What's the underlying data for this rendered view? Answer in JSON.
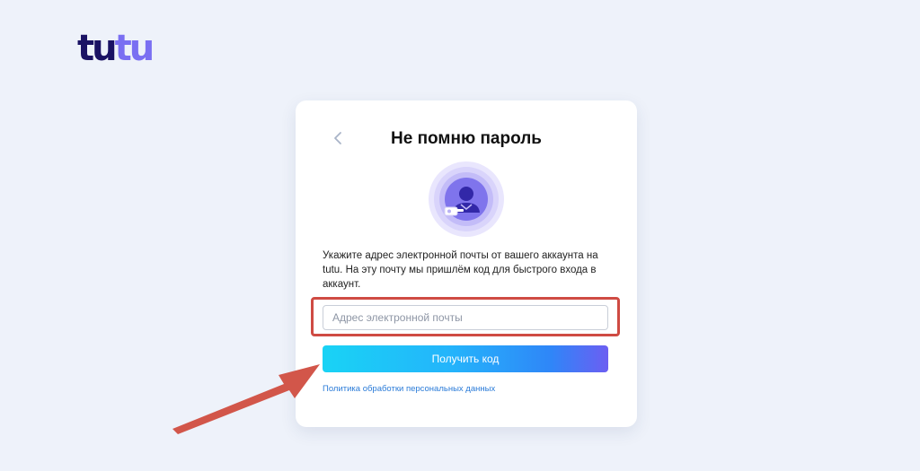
{
  "logo": {
    "part1": "tu",
    "part2": "tu"
  },
  "card": {
    "back_icon": "chevron-left-icon",
    "title": "Не помню пароль",
    "illustration_icon": "user-key-icon",
    "description": "Укажите адрес электронной почты от вашего аккаунта на tutu. На эту почту мы пришлём код для быстрого входа в аккаунт.",
    "email": {
      "value": "",
      "placeholder": "Адрес электронной почты"
    },
    "submit_label": "Получить код",
    "policy_link": "Политика обработки персональных данных"
  },
  "annotations": {
    "highlight_color": "#cf4b43",
    "arrow_color": "#d2564a"
  },
  "colors": {
    "background": "#eef2fa",
    "logo_dark": "#1a1264",
    "logo_light": "#7a6ff2",
    "link": "#2a7bd8",
    "button_gradient_start": "#19d3f5",
    "button_gradient_end": "#6c5ef2"
  }
}
